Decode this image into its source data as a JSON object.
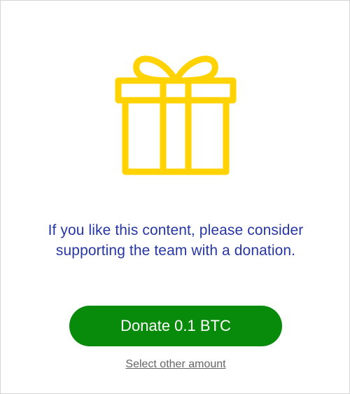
{
  "colors": {
    "icon": "#ffd200",
    "message_text": "#2637a5",
    "donate_button_bg": "#088a0a",
    "donate_button_text": "#ffffff",
    "link_text": "#666666"
  },
  "icon": {
    "name": "gift-icon"
  },
  "message": {
    "text": "If you like this content, please consider supporting the team with a donation."
  },
  "donate": {
    "label": "Donate 0.1 BTC"
  },
  "other_amount": {
    "label": "Select other amount"
  }
}
